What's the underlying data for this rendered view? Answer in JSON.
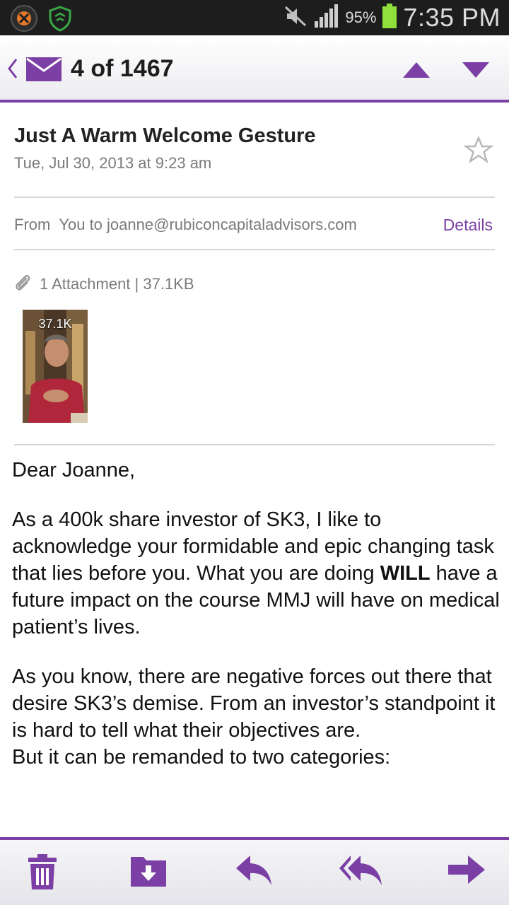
{
  "status_bar": {
    "battery_percent": "95%",
    "time": "7:35 PM",
    "icons": [
      "media-app-icon",
      "shield-icon",
      "mute-icon",
      "signal-icon",
      "battery-icon"
    ]
  },
  "header": {
    "counter": "4 of 1467",
    "icons": [
      "back-chevron-icon",
      "mail-icon",
      "up-arrow-icon",
      "down-arrow-icon"
    ]
  },
  "email": {
    "subject": "Just A Warm Welcome Gesture",
    "date": "Tue, Jul 30, 2013 at 9:23 am",
    "from_label": "From",
    "from_value": "You to joanne@rubiconcapitaladvisors.com",
    "details_label": "Details",
    "attachment_summary": "1 Attachment | 37.1KB",
    "thumb_size": "37.1K"
  },
  "body": {
    "greeting": "Dear Joanne,",
    "p1_before": "As a 400k share investor of SK3, I like to acknowledge your formidable and epic changing task that lies before you. What you are doing ",
    "p1_bold": "WILL",
    "p1_after": " have a future impact on the course MMJ will have on medical patient’s lives.",
    "p2_line1": "As you know, there are negative forces out there that desire SK3’s demise. From an investor’s standpoint it is hard to tell what their objectives are.",
    "p2_line2": "But it can be remanded to two categories:"
  },
  "toolbar": {
    "icons": [
      "trash-icon",
      "move-to-folder-icon",
      "reply-icon",
      "reply-all-icon",
      "forward-icon"
    ]
  },
  "colors": {
    "accent": "#7b3fa5",
    "status_bar_bg": "#1d1d1d",
    "muted_text": "#7a7a7a"
  }
}
